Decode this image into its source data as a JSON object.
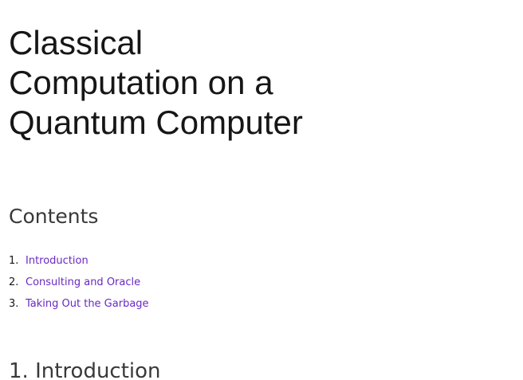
{
  "document": {
    "title_lines": [
      "Classical",
      "Computation on a",
      "Quantum Computer"
    ]
  },
  "contents": {
    "heading": "Contents",
    "items": [
      {
        "number": "1.",
        "label": "Introduction"
      },
      {
        "number": "2.",
        "label": "Consulting and Oracle"
      },
      {
        "number": "3.",
        "label": "Taking Out the Garbage"
      }
    ]
  },
  "section": {
    "heading": "1. Introduction"
  },
  "colors": {
    "link": "#6929c4",
    "title_text": "#161616",
    "heading_text": "#393939"
  }
}
